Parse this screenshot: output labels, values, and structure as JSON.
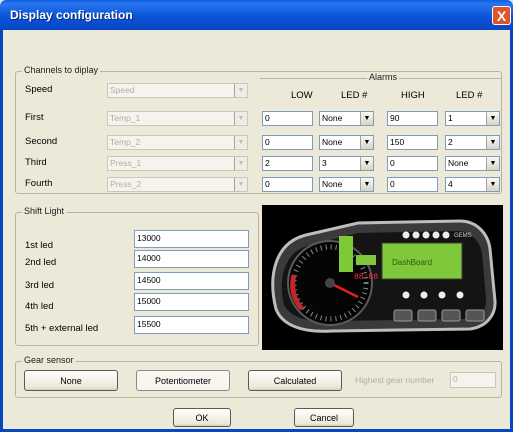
{
  "window": {
    "title": "Display configuration",
    "close": "X"
  },
  "channels": {
    "group_label": "Channels to diplay",
    "alarms_label": "Alarms",
    "headers": {
      "low": "LOW",
      "led1": "LED #",
      "high": "HIGH",
      "led2": "LED #"
    },
    "rows": [
      {
        "label": "Speed",
        "channel": "Speed"
      },
      {
        "label": "First",
        "channel": "Temp_1",
        "low": "0",
        "led_low": "None",
        "high": "90",
        "led_high": "1"
      },
      {
        "label": "Second",
        "channel": "Temp_2",
        "low": "0",
        "led_low": "None",
        "high": "150",
        "led_high": "2"
      },
      {
        "label": "Third",
        "channel": "Press_1",
        "low": "2",
        "led_low": "3",
        "high": "0",
        "led_high": "None"
      },
      {
        "label": "Fourth",
        "channel": "Press_2",
        "low": "0",
        "led_low": "None",
        "high": "0",
        "led_high": "4"
      }
    ]
  },
  "shift_light": {
    "group_label": "Shift Light",
    "leds": [
      {
        "label": "1st led",
        "value": "13000"
      },
      {
        "label": "2nd led",
        "value": "14000"
      },
      {
        "label": "3rd led",
        "value": "14500"
      },
      {
        "label": "4th led",
        "value": "15000"
      },
      {
        "label": "5th + external led",
        "value": "15500"
      }
    ]
  },
  "gear_sensor": {
    "group_label": "Gear sensor",
    "buttons": {
      "none": "None",
      "potentiometer": "Potentiometer",
      "calculated": "Calculated"
    },
    "highest_gear_label": "Highest gear number",
    "highest_gear_value": "0"
  },
  "footer": {
    "ok": "OK",
    "cancel": "Cancel"
  },
  "dashboard": {
    "brand": "GEMS",
    "display_text": "DashBoard",
    "rpm_readout": "88:88"
  }
}
